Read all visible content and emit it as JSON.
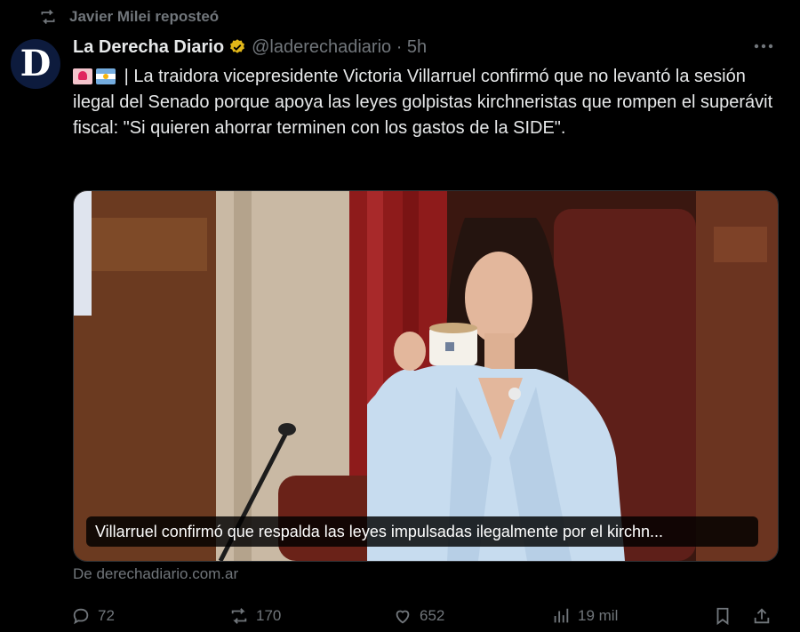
{
  "repost": {
    "label": "Javier Milei reposteó"
  },
  "author": {
    "avatar_letter": "D",
    "name": "La Derecha Diario",
    "handle_time": "@laderechadiario · 5h"
  },
  "tweet": {
    "emoji": [
      "police-light-emoji",
      "argentina-flag-emoji"
    ],
    "text": "| La traidora vicepresidente Victoria Villarruel confirmó que no levantó la sesión ilegal del Senado porque apoya las leyes golpistas kirchneristas que rompen el superávit fiscal: \"Si quieren ahorrar terminen con los gastos de la SIDE\"."
  },
  "media": {
    "caption": "Villarruel confirmó que respalda las leyes impulsadas ilegalmente por el kirchn...",
    "source": "De derechadiario.com.ar"
  },
  "actions": {
    "replies": "72",
    "reposts": "170",
    "likes": "652",
    "views": "19 mil"
  },
  "colors": {
    "background": "#000000",
    "text": "#e7e9ea",
    "secondary": "#71767b",
    "verified_gold": "#e2b719"
  }
}
